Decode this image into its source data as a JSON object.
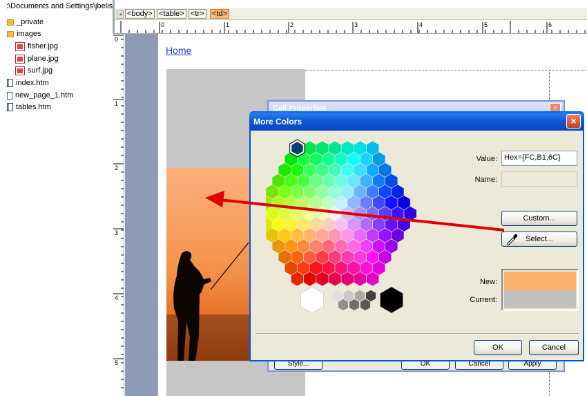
{
  "folder_list": {
    "path": ":\\Documents and Settings\\jbelis",
    "items": [
      {
        "label": "_private",
        "icon": "folder-icon"
      },
      {
        "label": "images",
        "icon": "folder-icon"
      },
      {
        "label": "fisher.jpg",
        "icon": "image-file-icon"
      },
      {
        "label": "plane.jpg",
        "icon": "image-file-icon"
      },
      {
        "label": "surf.jpg",
        "icon": "image-file-icon"
      },
      {
        "label": "index.htm",
        "icon": "page-file-icon"
      },
      {
        "label": "new_page_1.htm",
        "icon": "page-file-icon"
      },
      {
        "label": "tables.htm",
        "icon": "page-file-icon"
      }
    ]
  },
  "tag_bar": {
    "tags": [
      "<body>",
      "<table>",
      "<tr>",
      "<td>"
    ],
    "active_tag": "<td>"
  },
  "ruler": {
    "top_numbers": [
      "0",
      "1",
      "2",
      "3",
      "4",
      "5",
      "6"
    ],
    "left_numbers": [
      "0",
      "1",
      "2",
      "3",
      "4",
      "5"
    ]
  },
  "page": {
    "home_link": "Home"
  },
  "cell_properties_dialog": {
    "title": "Cell Properties",
    "close": "×",
    "buttons": [
      "Style...",
      "OK",
      "Cancel",
      "Apply"
    ]
  },
  "more_colors_dialog": {
    "title": "More Colors",
    "close": "×",
    "value_label": "Value:",
    "value": "Hex={FC,B1,6C}",
    "name_label": "Name:",
    "name_value": "",
    "custom_button": "Custom...",
    "select_button": "Select...",
    "new_label": "New:",
    "current_label": "Current:",
    "ok_button": "OK",
    "cancel_button": "Cancel",
    "new_color": "#fcb16c",
    "current_color": "#c0c0c0"
  },
  "colors": {
    "accent_blue": "#0054e3",
    "active_tag": "#f9b878",
    "arrow_red": "#e00000"
  }
}
